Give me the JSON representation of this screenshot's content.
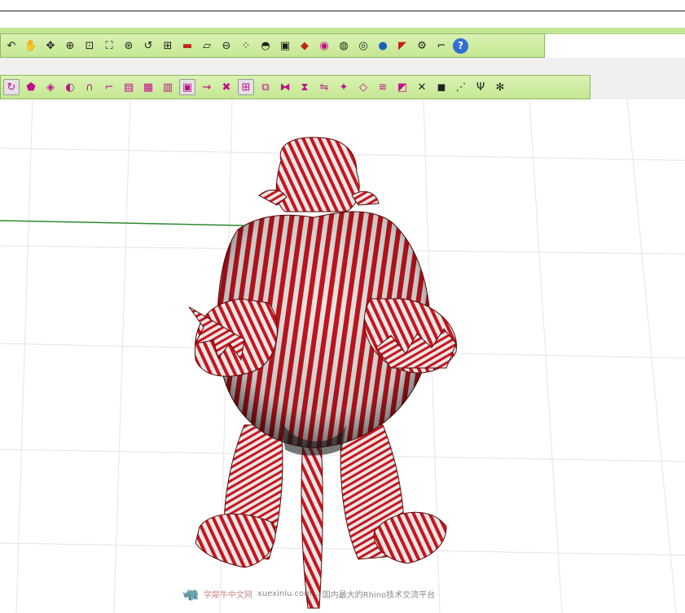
{
  "toolbar_top": {
    "buttons": [
      {
        "name": "undo-icon",
        "glyph": "↶",
        "tone": "k"
      },
      {
        "name": "pan-hand-icon",
        "glyph": "✋",
        "tone": "k"
      },
      {
        "name": "rotate-view-icon",
        "glyph": "✥",
        "tone": "k"
      },
      {
        "name": "zoom-icon",
        "glyph": "⊕",
        "tone": "k"
      },
      {
        "name": "zoom-window-icon",
        "glyph": "⊡",
        "tone": "k"
      },
      {
        "name": "zoom-extents-icon",
        "glyph": "⛶",
        "tone": "k"
      },
      {
        "name": "zoom-selected-icon",
        "glyph": "⊛",
        "tone": "k"
      },
      {
        "name": "undo-view-icon",
        "glyph": "↺",
        "tone": "k"
      },
      {
        "name": "four-viewports-icon",
        "glyph": "⊞",
        "tone": "k"
      },
      {
        "name": "car-icon",
        "glyph": "▬",
        "tone": "r"
      },
      {
        "name": "grid-plane-icon",
        "glyph": "▱",
        "tone": "k"
      },
      {
        "name": "cplane-icon",
        "glyph": "⊖",
        "tone": "k"
      },
      {
        "name": "select-points-icon",
        "glyph": "⁘",
        "tone": "k"
      },
      {
        "name": "light-bulb-icon",
        "glyph": "◓",
        "tone": "k"
      },
      {
        "name": "lock-icon",
        "glyph": "▣",
        "tone": "k"
      },
      {
        "name": "layer-icon",
        "glyph": "◆",
        "tone": "r"
      },
      {
        "name": "color-wheel-icon",
        "glyph": "◉",
        "tone": "p"
      },
      {
        "name": "wireframe-sphere-icon",
        "glyph": "◍",
        "tone": "k"
      },
      {
        "name": "ghosted-sphere-icon",
        "glyph": "◎",
        "tone": "k"
      },
      {
        "name": "shaded-sphere-icon",
        "glyph": "●",
        "tone": "b"
      },
      {
        "name": "spotlight-icon",
        "glyph": "◤",
        "tone": "r"
      },
      {
        "name": "gear-icon",
        "glyph": "⚙",
        "tone": "k"
      },
      {
        "name": "bracket-tool-icon",
        "glyph": "⌐",
        "tone": "k"
      },
      {
        "name": "help-icon",
        "glyph": "?",
        "tone": "help"
      }
    ]
  },
  "toolbar_bottom": {
    "buttons": [
      {
        "name": "rotate-surface-icon",
        "glyph": "↻",
        "tone": "m"
      },
      {
        "name": "pentagon-mesh-icon",
        "glyph": "⬟",
        "tone": "p"
      },
      {
        "name": "surface-from-curves-icon",
        "glyph": "◈",
        "tone": "p"
      },
      {
        "name": "loft-icon",
        "glyph": "◐",
        "tone": "p"
      },
      {
        "name": "arch-surface-icon",
        "glyph": "∩",
        "tone": "p"
      },
      {
        "name": "sweep-icon",
        "glyph": "⌐",
        "tone": "p"
      },
      {
        "name": "extrude-icon",
        "glyph": "▤",
        "tone": "p"
      },
      {
        "name": "network-surface-icon",
        "glyph": "▦",
        "tone": "p"
      },
      {
        "name": "patch-icon",
        "glyph": "▥",
        "tone": "p"
      },
      {
        "name": "edge-surface-icon",
        "glyph": "▣",
        "tone": "m"
      },
      {
        "name": "blend-icon",
        "glyph": "⇝",
        "tone": "p"
      },
      {
        "name": "trim-icon",
        "glyph": "✖",
        "tone": "p"
      },
      {
        "name": "split-icon",
        "glyph": "⊞",
        "tone": "m"
      },
      {
        "name": "join-icon",
        "glyph": "⧉",
        "tone": "p"
      },
      {
        "name": "rebuild-icon",
        "glyph": "⧓",
        "tone": "p"
      },
      {
        "name": "match-surface-icon",
        "glyph": "⧗",
        "tone": "p"
      },
      {
        "name": "flow-icon",
        "glyph": "⇋",
        "tone": "p"
      },
      {
        "name": "star-transform-icon",
        "glyph": "✦",
        "tone": "p"
      },
      {
        "name": "unroll-icon",
        "glyph": "◇",
        "tone": "p"
      },
      {
        "name": "offset-surface-icon",
        "glyph": "≋",
        "tone": "p"
      },
      {
        "name": "fillet-surface-icon",
        "glyph": "◩",
        "tone": "p"
      },
      {
        "name": "intersect-icon",
        "glyph": "✕",
        "tone": "k"
      },
      {
        "name": "cube-icon",
        "glyph": "◼",
        "tone": "k"
      },
      {
        "name": "point-cloud-icon",
        "glyph": "⋰",
        "tone": "k"
      },
      {
        "name": "branch-icon",
        "glyph": "Ψ",
        "tone": "k"
      },
      {
        "name": "settings-dot-icon",
        "glyph": "✻",
        "tone": "k"
      }
    ]
  },
  "watermark": {
    "name": "学犀牛中文网",
    "url": "xuexiniu.com",
    "tagline": "- 国内最大的Rhino技术交流平台"
  },
  "colors": {
    "toolbar_green": "#c5e793",
    "zebra_red": "#c9141c",
    "zebra_light": "#e9e9e9",
    "axis_green": "#2f8a2f",
    "grid_line": "#e4e4e4"
  }
}
